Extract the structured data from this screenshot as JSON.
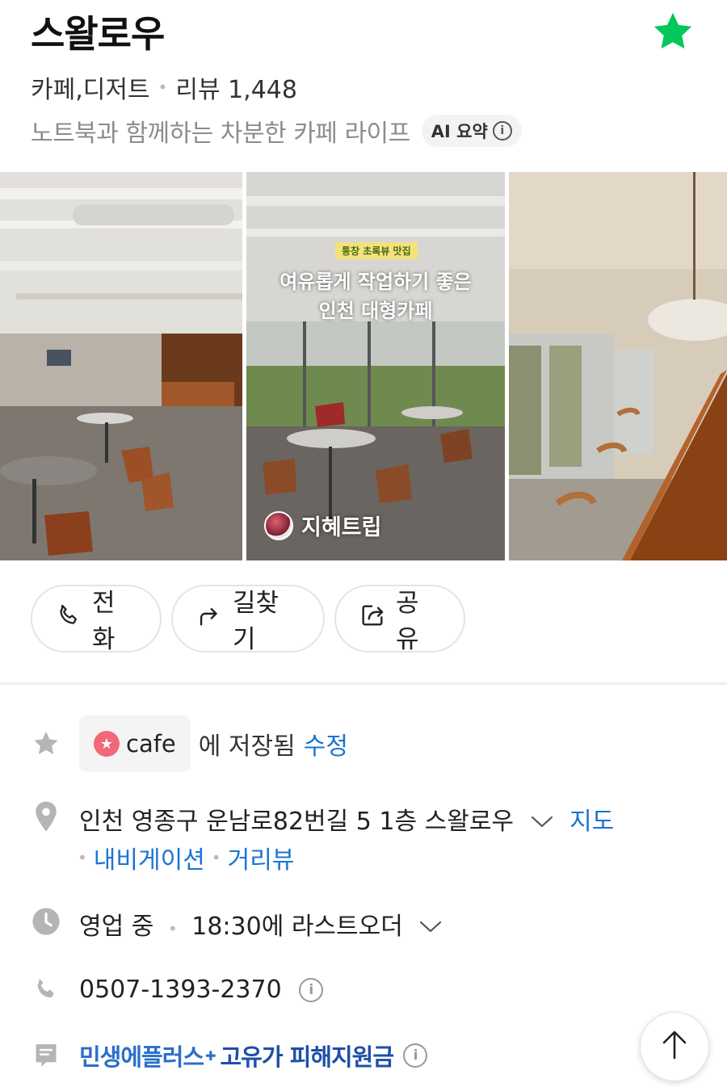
{
  "header": {
    "place_name": "스왈로우",
    "category": "카페,디저트",
    "review_label": "리뷰 1,448",
    "description": "노트북과 함께하는 차분한 카페 라이프",
    "ai_badge": "AI 요약",
    "info_glyph": "i",
    "favorite_color": "#03c75a"
  },
  "photos": {
    "photo2_tag": "통창 초록뷰 맛집",
    "photo2_title_line1": "여유롭게 작업하기 좋은",
    "photo2_title_line2": "인천 대형카페",
    "photo2_author": "지혜트립"
  },
  "actions": {
    "call": "전화",
    "route": "길찾기",
    "share": "공유"
  },
  "saved": {
    "chip_label": "cafe",
    "saved_text": "에 저장됨",
    "edit_label": "수정"
  },
  "address": {
    "text": "인천 영종구 운남로82번길 5 1층 스왈로우",
    "map_link": "지도",
    "navigation_link": "내비게이션",
    "street_view_link": "거리뷰"
  },
  "hours": {
    "status": "영업 중",
    "last_order": "18:30에 라스트오더"
  },
  "phone": {
    "number": "0507-1393-2370"
  },
  "promo": {
    "part1": "민생에플러스",
    "part2": "고유가 피해지원금"
  },
  "colors": {
    "link": "#1a74d4",
    "icon_gray": "#b5b5b5"
  }
}
